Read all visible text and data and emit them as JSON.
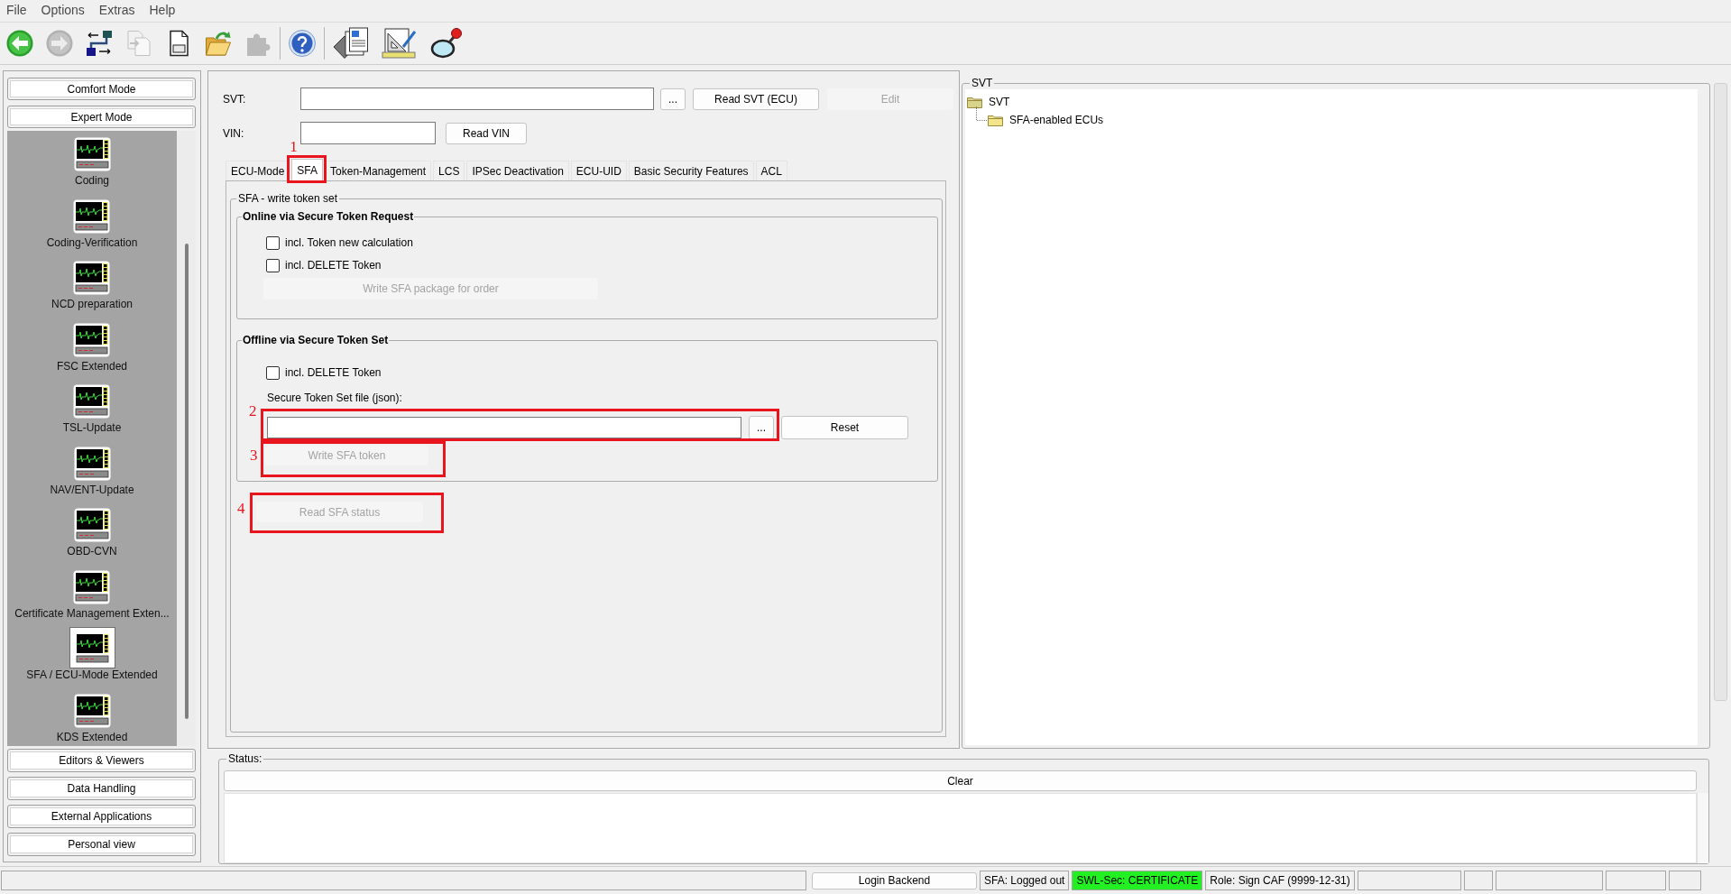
{
  "menu": [
    {
      "label": "File"
    },
    {
      "label": "Options"
    },
    {
      "label": "Extras"
    },
    {
      "label": "Help"
    }
  ],
  "toolbar": {
    "groups": [
      [
        {
          "kind": "back",
          "disabled": false
        },
        {
          "kind": "forward",
          "disabled": true
        },
        {
          "kind": "flow",
          "disabled": false
        },
        {
          "kind": "copy",
          "disabled": true
        },
        {
          "kind": "log",
          "disabled": false
        },
        {
          "kind": "folder",
          "disabled": false
        },
        {
          "kind": "plugin",
          "disabled": true
        }
      ],
      [
        {
          "kind": "help",
          "disabled": false
        }
      ],
      [
        {
          "kind": "documents",
          "disabled": false
        },
        {
          "kind": "ruler",
          "disabled": false
        },
        {
          "kind": "magnifier",
          "disabled": false
        }
      ]
    ]
  },
  "sidebar": {
    "top_buttons": [
      {
        "label": "Comfort Mode"
      },
      {
        "label": "Expert Mode"
      }
    ],
    "items": [
      {
        "label": "Coding",
        "selected": false
      },
      {
        "label": "Coding-Verification",
        "selected": false
      },
      {
        "label": "NCD preparation",
        "selected": false
      },
      {
        "label": "FSC Extended",
        "selected": false
      },
      {
        "label": "TSL-Update",
        "selected": false
      },
      {
        "label": "NAV/ENT-Update",
        "selected": false
      },
      {
        "label": "OBD-CVN",
        "selected": false
      },
      {
        "label": "Certificate Management Exten...",
        "selected": false
      },
      {
        "label": "SFA / ECU-Mode Extended",
        "selected": true
      },
      {
        "label": "KDS Extended",
        "selected": false
      }
    ],
    "bottom_buttons": [
      {
        "label": "Editors & Viewers"
      },
      {
        "label": "Data Handling"
      },
      {
        "label": "External Applications"
      },
      {
        "label": "Personal view"
      }
    ]
  },
  "form": {
    "svt": {
      "label": "SVT:",
      "browse_button": {
        "label": "...",
        "disabled": false
      },
      "read_button": {
        "label": "Read SVT (ECU)",
        "disabled": false
      },
      "edit_button": {
        "label": "Edit",
        "disabled": true
      }
    },
    "vin": {
      "label": "VIN:",
      "read_button": {
        "label": "Read VIN",
        "disabled": false
      }
    }
  },
  "tabs": [
    {
      "label": "ECU-Mode",
      "selected": false
    },
    {
      "label": "SFA",
      "selected": true,
      "annotation": "1"
    },
    {
      "label": "Token-Management",
      "selected": false
    },
    {
      "label": "LCS",
      "selected": false
    },
    {
      "label": "IPSec Deactivation",
      "selected": false
    },
    {
      "label": "ECU-UID",
      "selected": false
    },
    {
      "label": "Basic Security Features",
      "selected": false
    },
    {
      "label": "ACL",
      "selected": false
    }
  ],
  "sfa_panel": {
    "title": "SFA - write token set",
    "online": {
      "title": "Online via Secure Token Request",
      "checkboxes": [
        {
          "label": "incl. Token new calculation",
          "checked": false
        },
        {
          "label": "incl. DELETE Token",
          "checked": false
        }
      ],
      "button": {
        "label": "Write SFA package for order",
        "disabled": true
      }
    },
    "offline": {
      "title": "Offline via Secure Token Set",
      "checkboxes": [
        {
          "label": "incl. DELETE Token",
          "checked": false
        }
      ],
      "file_label": "Secure Token Set file (json):",
      "file_field": {
        "annotation": "2"
      },
      "browse_button": {
        "label": "...",
        "disabled": false
      },
      "reset_button": {
        "label": "Reset",
        "disabled": false
      },
      "write_button": {
        "label": "Write SFA token",
        "disabled": true,
        "annotation": "3"
      }
    },
    "read_status_button": {
      "label": "Read SFA status",
      "disabled": true,
      "annotation": "4"
    }
  },
  "svt_panel": {
    "title": "SVT",
    "tree": [
      {
        "label": "SVT",
        "children": [
          {
            "label": "SFA-enabled ECUs"
          }
        ]
      }
    ]
  },
  "status_panel": {
    "title": "Status:",
    "clear_button": {
      "label": "Clear",
      "disabled": false
    }
  },
  "status_bar": {
    "login_button": {
      "label": "Login Backend",
      "disabled": false
    },
    "cells": [
      {
        "text": "SFA: Logged out"
      },
      {
        "text": "SWL-Sec: CERTIFICATE",
        "color": "#22f022"
      },
      {
        "text": "Role: Sign CAF (9999-12-31)"
      }
    ]
  }
}
